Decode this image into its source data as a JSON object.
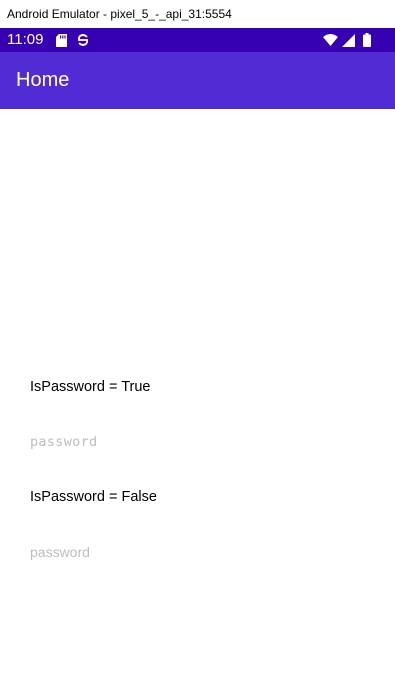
{
  "window": {
    "title": "Android Emulator - pixel_5_-_api_31:5554"
  },
  "status_bar": {
    "time": "11:09",
    "left_icons": [
      "sd-card-icon",
      "sync-icon"
    ],
    "right_icons": [
      "wifi-icon",
      "signal-icon",
      "battery-icon"
    ],
    "color": "#3700b3"
  },
  "app_bar": {
    "title": "Home",
    "color": "#512bd4"
  },
  "main": {
    "label_password_true": "IsPassword = True",
    "entry_password_true": {
      "value": "",
      "placeholder": "password"
    },
    "label_password_false": "IsPassword = False",
    "entry_password_false": {
      "value": "",
      "placeholder": "password"
    }
  }
}
